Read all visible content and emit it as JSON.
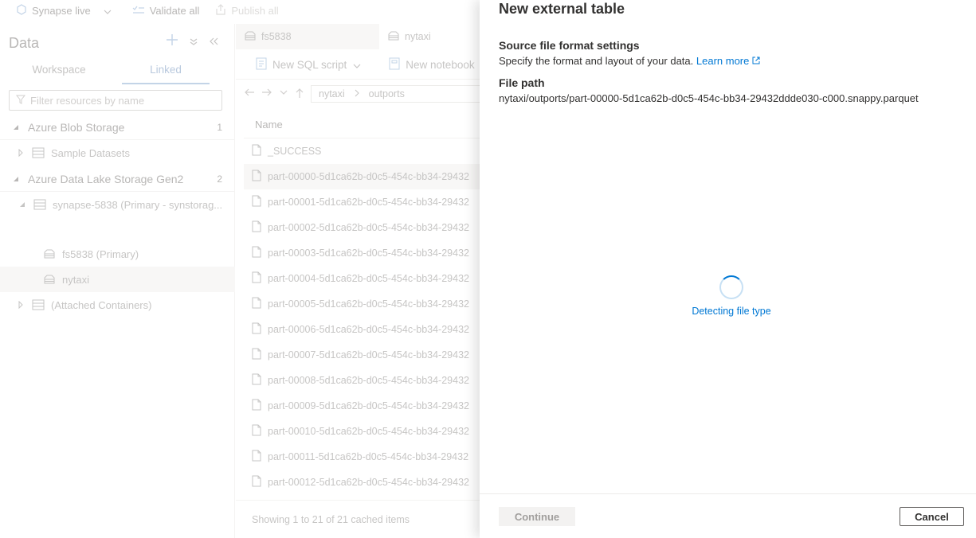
{
  "topbar": {
    "synapse_live": "Synapse live",
    "validate_all": "Validate all",
    "publish_all": "Publish all"
  },
  "left": {
    "title": "Data",
    "tabs": [
      "Workspace",
      "Linked"
    ],
    "active_tab": "Linked",
    "filter_placeholder": "Filter resources by name",
    "tree": {
      "blob": {
        "label": "Azure Blob Storage",
        "count": "1"
      },
      "sample": {
        "label": "Sample Datasets"
      },
      "adls": {
        "label": "Azure Data Lake Storage Gen2",
        "count": "2"
      },
      "synapse": {
        "label": "synapse-5838 (Primary - synstorag..."
      },
      "fs": {
        "label": "fs5838 (Primary)"
      },
      "nytaxi": {
        "label": "nytaxi"
      },
      "attached": {
        "label": "(Attached Containers)"
      }
    }
  },
  "middle": {
    "tabs": [
      "fs5838",
      "nytaxi"
    ],
    "toolbar": {
      "new_sql": "New SQL script",
      "new_notebook": "New notebook"
    },
    "breadcrumb": [
      "nytaxi",
      "outports"
    ],
    "column_name": "Name",
    "files": [
      "_SUCCESS",
      "part-00000-5d1ca62b-d0c5-454c-bb34-29432",
      "part-00001-5d1ca62b-d0c5-454c-bb34-29432",
      "part-00002-5d1ca62b-d0c5-454c-bb34-29432",
      "part-00003-5d1ca62b-d0c5-454c-bb34-29432",
      "part-00004-5d1ca62b-d0c5-454c-bb34-29432",
      "part-00005-5d1ca62b-d0c5-454c-bb34-29432",
      "part-00006-5d1ca62b-d0c5-454c-bb34-29432",
      "part-00007-5d1ca62b-d0c5-454c-bb34-29432",
      "part-00008-5d1ca62b-d0c5-454c-bb34-29432",
      "part-00009-5d1ca62b-d0c5-454c-bb34-29432",
      "part-00010-5d1ca62b-d0c5-454c-bb34-29432",
      "part-00011-5d1ca62b-d0c5-454c-bb34-29432",
      "part-00012-5d1ca62b-d0c5-454c-bb34-29432"
    ],
    "showing": "Showing 1 to 21 of 21 cached items"
  },
  "panel": {
    "title": "New external table",
    "section_title": "Source file format settings",
    "section_desc": "Specify the format and layout of your data.",
    "learn_more": "Learn more",
    "file_path_label": "File path",
    "file_path_value": "nytaxi/outports/part-00000-5d1ca62b-d0c5-454c-bb34-29432ddde030-c000.snappy.parquet",
    "loading_text": "Detecting file type",
    "continue_label": "Continue",
    "cancel_label": "Cancel"
  },
  "colors": {
    "accent": "#0078d4"
  }
}
